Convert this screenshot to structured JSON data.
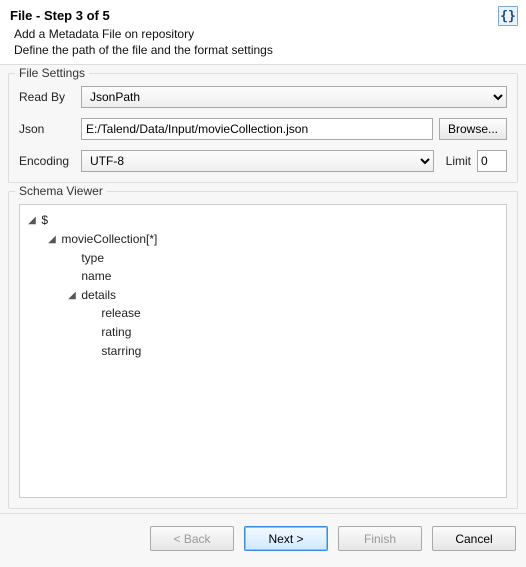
{
  "header": {
    "title": "File - Step 3 of 5",
    "subtitle_line1": "Add a Metadata File on repository",
    "subtitle_line2": "Define the path of the file and the format settings",
    "icon_glyph": "{}"
  },
  "file_settings": {
    "group_title": "File Settings",
    "read_by_label": "Read By",
    "read_by_value": "JsonPath",
    "json_label": "Json",
    "json_value": "E:/Talend/Data/Input/movieCollection.json",
    "browse_label": "Browse...",
    "encoding_label": "Encoding",
    "encoding_value": "UTF-8",
    "limit_label": "Limit",
    "limit_value": "0"
  },
  "schema": {
    "group_title": "Schema Viewer",
    "root": "$",
    "collection": "movieCollection[*]",
    "type": "type",
    "name": "name",
    "details": "details",
    "release": "release",
    "rating": "rating",
    "starring": "starring"
  },
  "footer": {
    "back": "< Back",
    "next": "Next >",
    "finish": "Finish",
    "cancel": "Cancel"
  }
}
